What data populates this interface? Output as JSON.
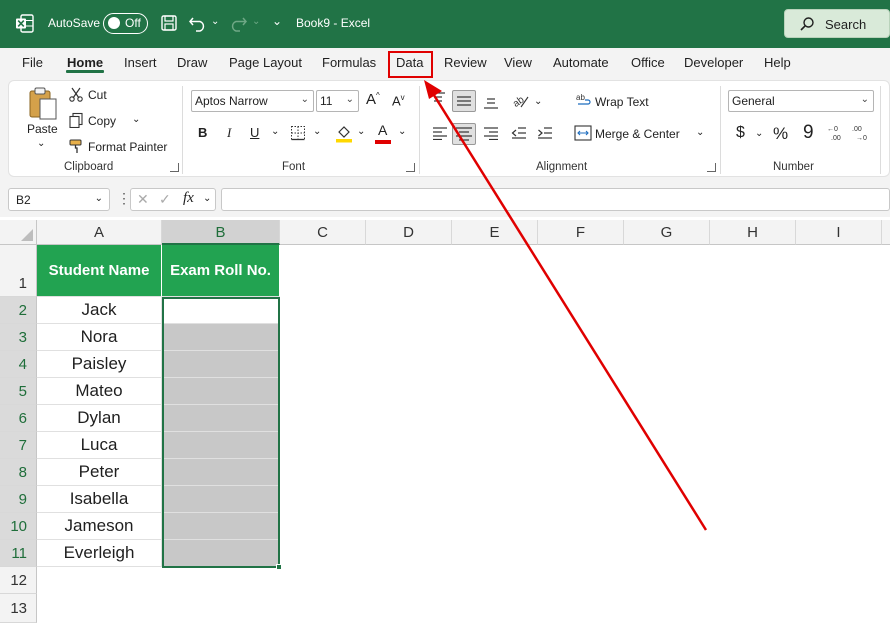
{
  "titlebar": {
    "autosave_label": "AutoSave",
    "autosave_state": "Off",
    "document_title": "Book9  -  Excel",
    "search_label": "Search",
    "bg_color": "#217346"
  },
  "menu": {
    "tabs": [
      "File",
      "Home",
      "Insert",
      "Draw",
      "Page Layout",
      "Formulas",
      "Data",
      "Review",
      "View",
      "Automate",
      "Office",
      "Developer",
      "Help"
    ],
    "active_tab": "Home",
    "highlighted_tab": "Data",
    "highlight_color": "#e00000"
  },
  "ribbon": {
    "clipboard": {
      "paste": "Paste",
      "cut": "Cut",
      "copy": "Copy",
      "format_painter": "Format Painter",
      "label": "Clipboard"
    },
    "font": {
      "font_name": "Aptos Narrow",
      "font_size": "11",
      "bold": "B",
      "italic": "I",
      "underline": "U",
      "label": "Font"
    },
    "alignment": {
      "wrap_text": "Wrap Text",
      "merge_center": "Merge & Center",
      "label": "Alignment"
    },
    "number": {
      "format": "General",
      "currency": "$",
      "percent": "%",
      "comma": "9",
      "label": "Number"
    }
  },
  "formula_bar": {
    "name_box": "B2",
    "fx": "fx",
    "formula": ""
  },
  "sheet": {
    "columns": [
      "A",
      "B",
      "C",
      "D",
      "E",
      "F",
      "G",
      "H",
      "I"
    ],
    "selected_column": "B",
    "rows": [
      "1",
      "2",
      "3",
      "4",
      "5",
      "6",
      "7",
      "8",
      "9",
      "10",
      "11",
      "12",
      "13"
    ],
    "header_row": {
      "A": "Student Name",
      "B": "Exam Roll No."
    },
    "student_names": [
      "Jack",
      "Nora",
      "Paisley",
      "Mateo",
      "Dylan",
      "Luca",
      "Peter",
      "Isabella",
      "Jameson",
      "Everleigh"
    ],
    "header_fill": "#22a351",
    "selected_range_fill": "#c8c8c8",
    "selection_color": "#217346"
  },
  "annotation": {
    "arrow_color": "#e00000"
  }
}
